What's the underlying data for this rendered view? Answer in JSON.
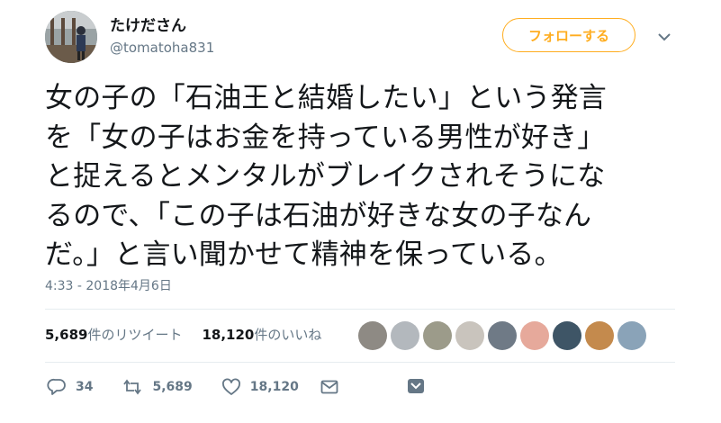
{
  "user": {
    "display_name": "たけださん",
    "handle": "@tomatoha831"
  },
  "follow_button": {
    "label": "フォローする"
  },
  "tweet": {
    "text": "女の子の「石油王と結婚したい」という発言\nを「女の子はお金を持っている男性が好き」\nと捉えるとメンタルがブレイクされそうにな\nるので、「この子は石油が好きな女の子なん\nだ。」と言い聞かせて精神を保っている。",
    "timestamp": "4:33 - 2018年4月6日"
  },
  "stats": {
    "retweets_count": "5,689",
    "retweets_label": "件のリツイート",
    "likes_count": "18,120",
    "likes_label": "件のいいね"
  },
  "actions": {
    "replies": "34",
    "retweets": "5,689",
    "likes": "18,120"
  },
  "colors": {
    "accent": "#ffad1f",
    "secondary_text": "#657786",
    "primary_text": "#14171a",
    "liker_avatars": [
      "#8e8a84",
      "#b3b8bd",
      "#9c9b8a",
      "#c9c4bd",
      "#6f7a86",
      "#e6a99b",
      "#3e5566",
      "#c48a4d",
      "#8aa3b8"
    ]
  }
}
